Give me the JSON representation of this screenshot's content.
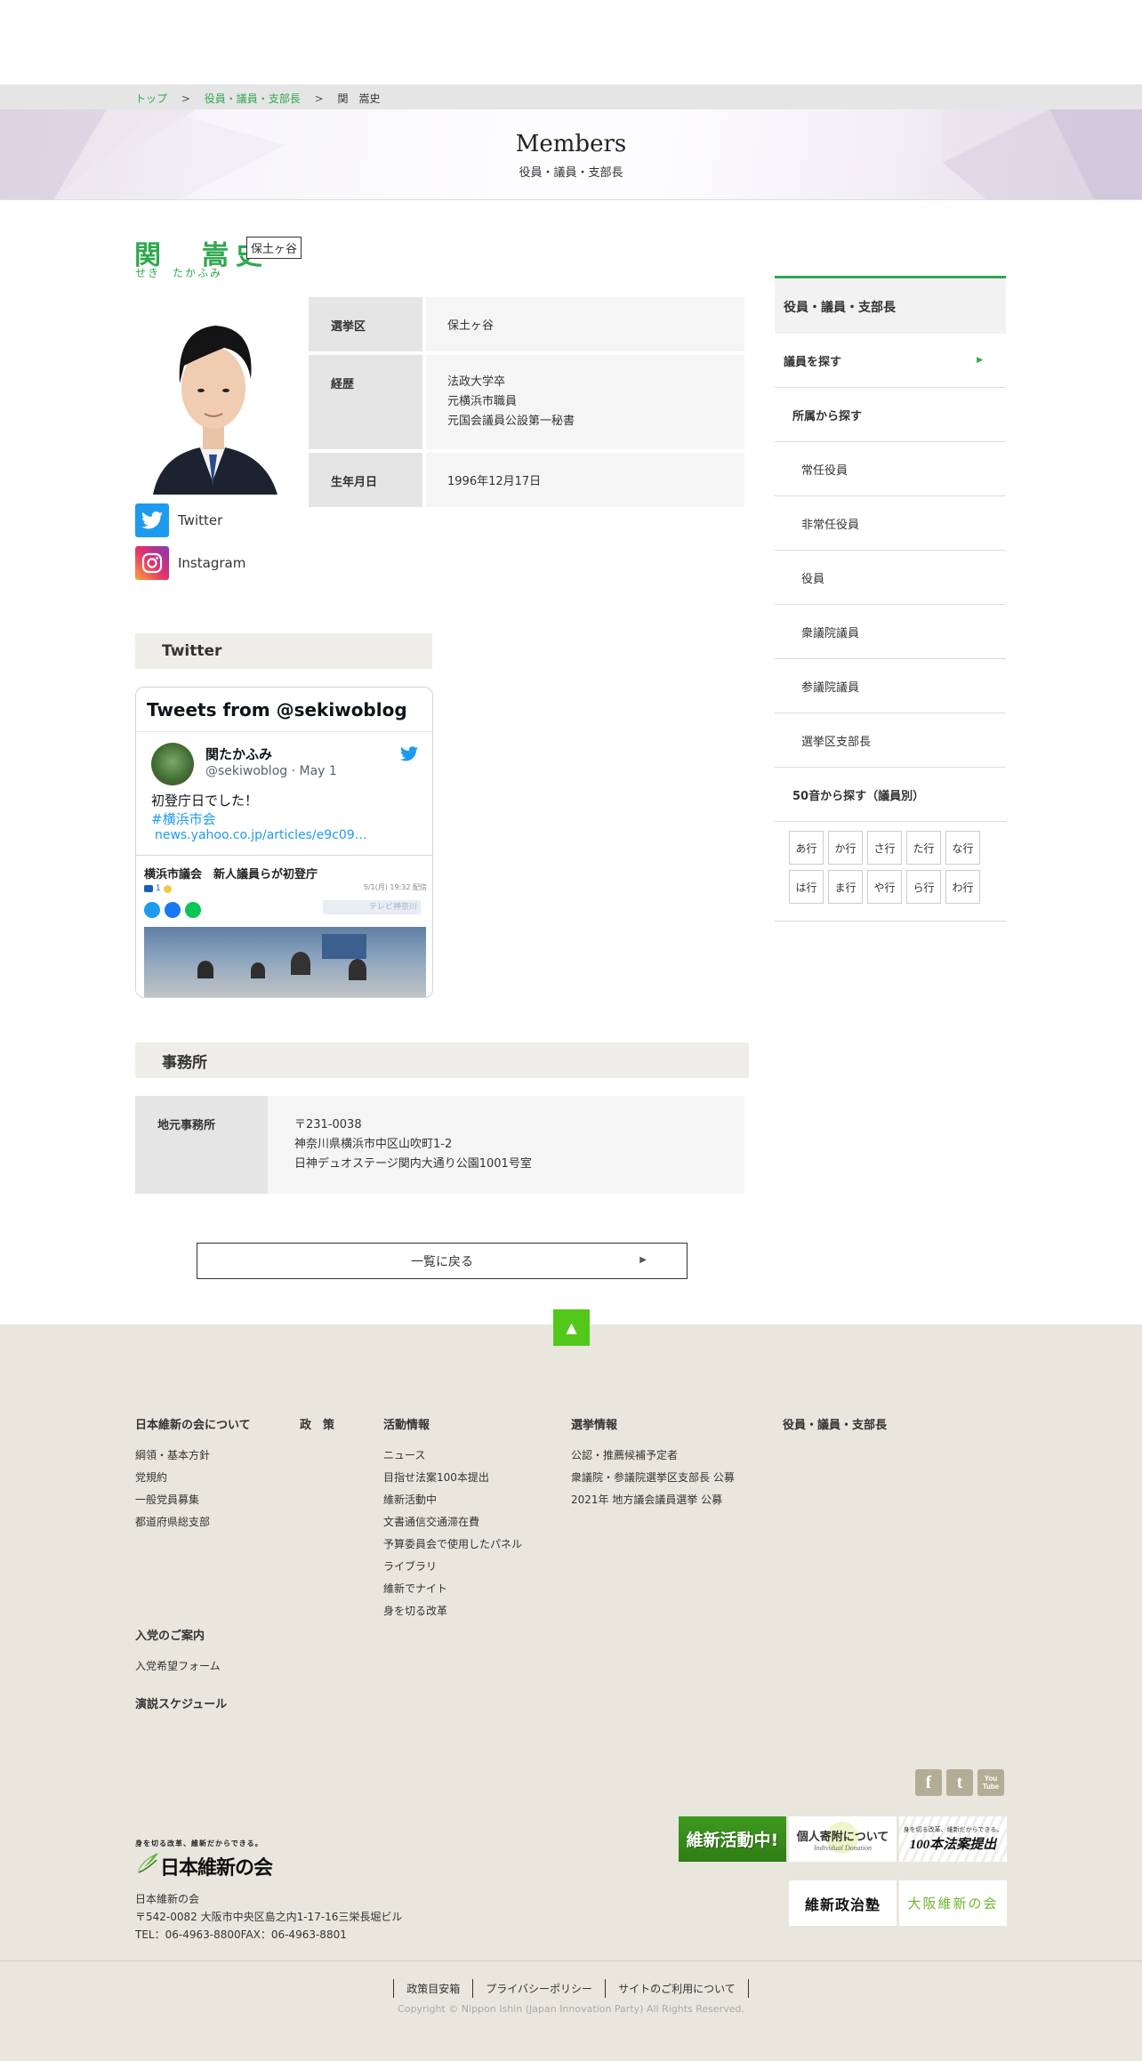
{
  "breadcrumb": {
    "home": "トップ",
    "section": "役員・議員・支部長",
    "current": "関　嵩史",
    "sep": ">"
  },
  "hero": {
    "title": "Members",
    "subtitle": "役員・議員・支部長"
  },
  "member": {
    "name": "関　嵩史",
    "kana": "せき　たかふみ",
    "district_tag": "保土ヶ谷",
    "profile": [
      {
        "label": "選挙区",
        "value": [
          "保土ヶ谷"
        ]
      },
      {
        "label": "経歴",
        "value": [
          "法政大学卒",
          "元横浜市職員",
          "元国会議員公設第一秘書"
        ]
      },
      {
        "label": "生年月日",
        "value": [
          "1996年12月17日"
        ]
      }
    ],
    "sns": [
      {
        "label": "Twitter",
        "icon": "twitter-icon"
      },
      {
        "label": "Instagram",
        "icon": "instagram-icon"
      }
    ]
  },
  "twitter_section": {
    "heading": "Twitter",
    "widget_title": "Tweets from @sekiwoblog",
    "author_name": "関たかふみ",
    "author_meta": "@sekiwoblog · May 1",
    "text": "初登庁日でした！",
    "hashtag": "#横浜市会",
    "link": "news.yahoo.co.jp/articles/e9c09…",
    "embed_title": "横浜市議会　新人議員らが初登庁",
    "embed_date": "5/1(月) 19:32 配信",
    "embed_count": "1",
    "embed_source": "テレビ神奈川"
  },
  "office_section": {
    "heading": "事務所",
    "label": "地元事務所",
    "lines": [
      "〒231-0038",
      "神奈川県横浜市中区山吹町1-2",
      "日神デュオステージ関内大通り公園1001号室"
    ]
  },
  "back_button": "一覧に戻る",
  "sidebar": {
    "title": "役員・議員・支部長",
    "search_members": "議員を探す",
    "by_affiliation": "所属から探す",
    "affiliations": [
      "常任役員",
      "非常任役員",
      "役員",
      "衆議院議員",
      "参議院議員",
      "選挙区支部長"
    ],
    "by_kana": "50音から探す（議員別）",
    "kana_rows": [
      "あ行",
      "か行",
      "さ行",
      "た行",
      "な行",
      "は行",
      "ま行",
      "や行",
      "ら行",
      "わ行"
    ]
  },
  "footer": {
    "col1": {
      "heading": "日本維新の会について",
      "links": [
        "綱領・基本方針",
        "党規約",
        "一般党員募集",
        "都道府県総支部"
      ]
    },
    "col2": {
      "heading": "政　策"
    },
    "col3": {
      "heading": "活動情報",
      "links": [
        "ニュース",
        "目指せ法案100本提出",
        "維新活動中",
        "文書通信交通滞在費",
        "予算委員会で使用したパネル",
        "ライブラリ",
        "維新でナイト",
        "身を切る改革"
      ]
    },
    "col4": {
      "heading": "選挙情報",
      "links": [
        "公認・推薦候補予定者",
        "衆議院・参議院選挙区支部長 公募",
        "2021年 地方議会議員選挙 公募"
      ]
    },
    "col5": {
      "heading": "役員・議員・支部長"
    },
    "join": {
      "heading": "入党のご案内",
      "link": "入党希望フォーム"
    },
    "speech": "演説スケジュール",
    "logo_tagline": "身を切る改革、維新だからできる。",
    "logo_name": "日本維新の会",
    "org_name": "日本維新の会",
    "address": "〒542-0082 大阪市中央区島之内1-17-16三栄長堀ビル",
    "tel": "TEL：06-4963-8800FAX：06-4963-8801",
    "banners": {
      "active": "維新活動中!",
      "donation": "個人寄附について",
      "donation_sub": "Individual Donation",
      "bills_tag": "身を切る改革、維新だからできる。",
      "bills": "100本法案提出",
      "school": "維新政治塾",
      "osaka": "大阪維新の会"
    },
    "social": {
      "facebook": "f",
      "twitter": "t",
      "youtube": "You Tube"
    },
    "nav": [
      "政策目安箱",
      "プライバシーポリシー",
      "サイトのご利用について"
    ],
    "copyright": "Copyright © Nippon Ishin (Japan Innovation Party) All Rights Reserved."
  },
  "colors": {
    "accent": "#2fa84f",
    "pagetop": "#53c81a",
    "footer_bg": "#e9e6de"
  }
}
